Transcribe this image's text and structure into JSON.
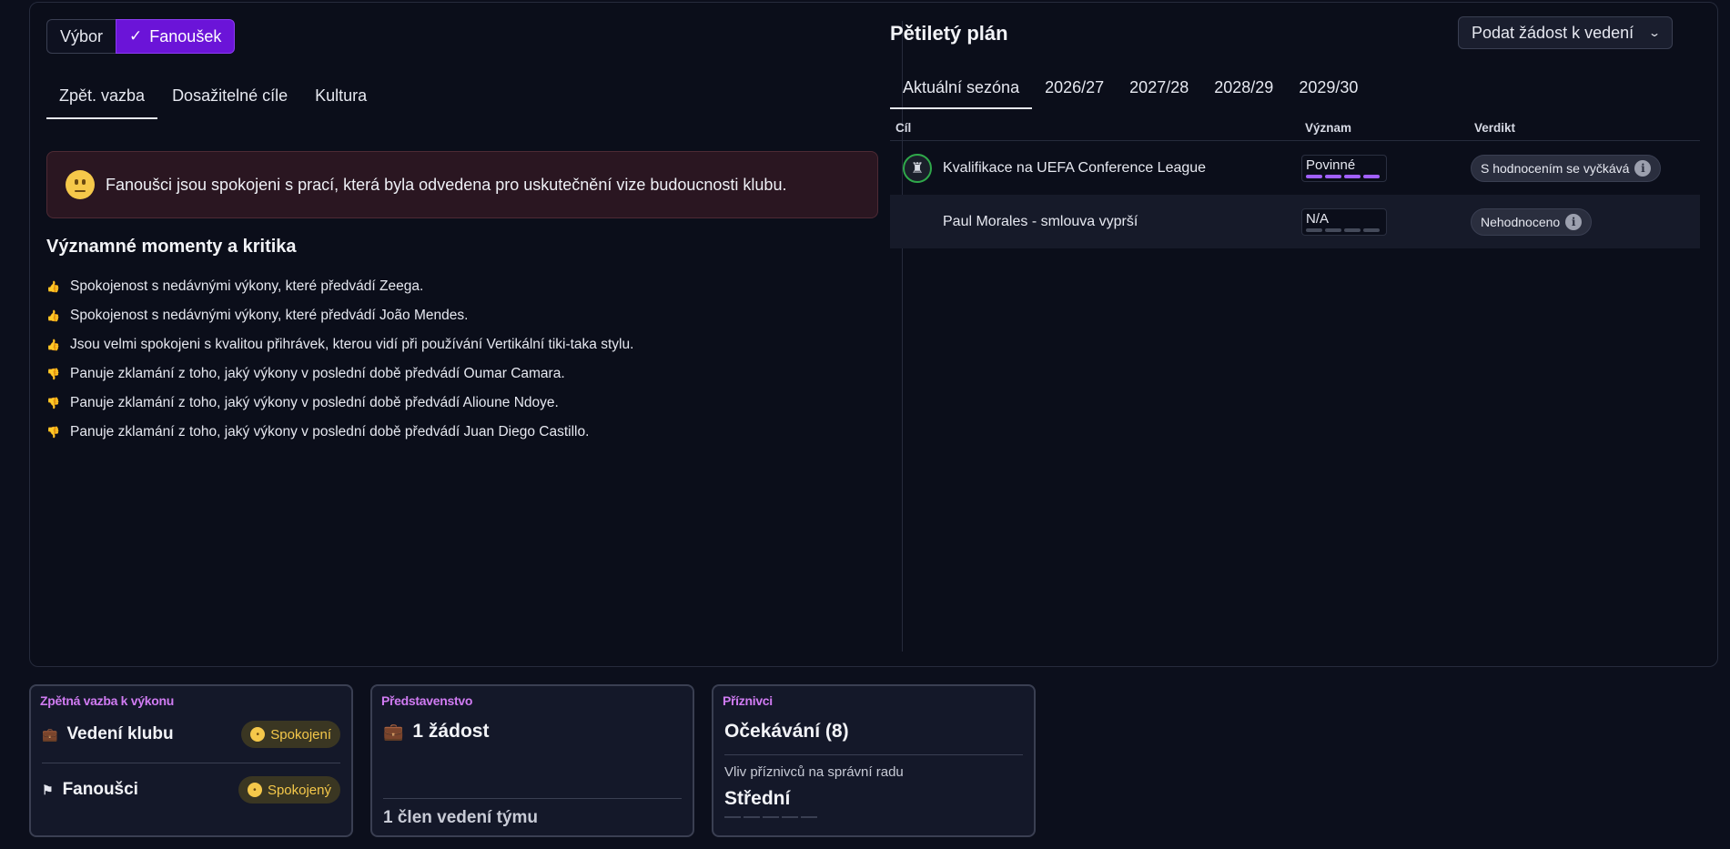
{
  "toggle": {
    "option1": "Výbor",
    "option2": "Fanoušek",
    "active": "Fanoušek"
  },
  "left_tabs": [
    "Zpět. vazba",
    "Dosažitelné cíle",
    "Kultura"
  ],
  "banner": {
    "text": "Fanoušci jsou spokojeni s prací, která byla odvedena pro uskutečnění vize budoucnosti klubu."
  },
  "moments": {
    "title": "Významné momenty a kritika",
    "items": [
      {
        "text": "Spokojenost s nedávnými výkony, které předvádí Zeega.",
        "type": "positive"
      },
      {
        "text": "Spokojenost s nedávnými výkony, které předvádí João Mendes.",
        "type": "positive"
      },
      {
        "text": "Jsou velmi spokojeni s kvalitou přihrávek, kterou vidí při používání Vertikální tiki-taka stylu.",
        "type": "positive"
      },
      {
        "text": "Panuje zklamání z toho, jaký výkony v poslední době předvádí Oumar Camara.",
        "type": "negative"
      },
      {
        "text": "Panuje zklamání z toho, jaký výkony v poslední době předvádí Alioune Ndoye.",
        "type": "negative"
      },
      {
        "text": "Panuje zklamání z toho, jaký výkony v poslední době předvádí Juan Diego Castillo.",
        "type": "negative"
      }
    ]
  },
  "plan": {
    "title": "Pětiletý plán",
    "request_button": "Podat žádost k vedení",
    "tabs": [
      "Aktuální sezóna",
      "2026/27",
      "2027/28",
      "2028/29",
      "2029/30"
    ],
    "columns": {
      "goal": "Cíl",
      "significance": "Význam",
      "verdict": "Verdikt"
    },
    "rows": [
      {
        "goal": "Kvalifikace na UEFA Conference League",
        "significance": "Povinné",
        "significance_level": 4,
        "verdict": "S hodnocením se vyčkává",
        "icon": "trophy-icon"
      },
      {
        "goal": "Paul Morales - smlouva vyprší",
        "significance": "N/A",
        "significance_level": 0,
        "verdict": "Nehodnoceno",
        "icon": ""
      }
    ]
  },
  "cards": {
    "feedback": {
      "label": "Zpětná vazba k výkonu",
      "row1": {
        "title": "Vedení klubu",
        "status": "Spokojení"
      },
      "row2": {
        "title": "Fanoušci",
        "status": "Spokojený"
      }
    },
    "board": {
      "label": "Představenstvo",
      "requests": "1 žádost",
      "staff": "1 člen vedení týmu"
    },
    "supporters": {
      "label": "Příznivci",
      "expectation": "Očekávání (8)",
      "influence_label": "Vliv příznivců na správní radu",
      "influence_value": "Střední"
    }
  },
  "colors": {
    "accent": "#6b14d8",
    "positive": "#3cd05a",
    "negative": "#f04a64",
    "label": "#d07bf2",
    "status_yellow": "#f5c84a"
  }
}
